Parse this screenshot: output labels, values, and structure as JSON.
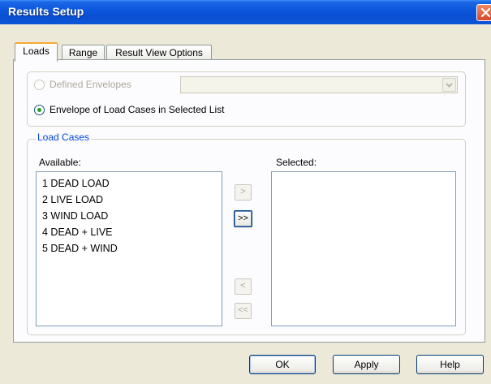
{
  "window": {
    "title": "Results Setup",
    "close_icon": "close-icon"
  },
  "tabs": [
    {
      "label": "Loads",
      "active": true
    },
    {
      "label": "Range",
      "active": false
    },
    {
      "label": "Result View Options",
      "active": false
    }
  ],
  "envelope": {
    "defined_envelopes_label": "Defined Envelopes",
    "defined_envelopes_checked": false,
    "defined_envelopes_enabled": false,
    "defined_envelopes_value": "",
    "load_cases_envelope_label": "Envelope of Load Cases in Selected List",
    "load_cases_envelope_checked": true
  },
  "load_cases": {
    "group_label": "Load Cases",
    "available_label": "Available:",
    "selected_label": "Selected:",
    "available": [
      "1 DEAD LOAD",
      "2 LIVE LOAD",
      "3 WIND LOAD",
      "4 DEAD + LIVE",
      "5 DEAD + WIND"
    ],
    "selected": [],
    "add_label": ">",
    "add_all_label": ">>",
    "remove_label": "<",
    "remove_all_label": "<<"
  },
  "buttons": {
    "ok": "OK",
    "apply": "Apply",
    "help": "Help"
  },
  "colors": {
    "title_bar": "#0a4fd1",
    "group_label": "#0046d5",
    "tab_highlight": "#f8a933",
    "radio_dot": "#21a121"
  }
}
